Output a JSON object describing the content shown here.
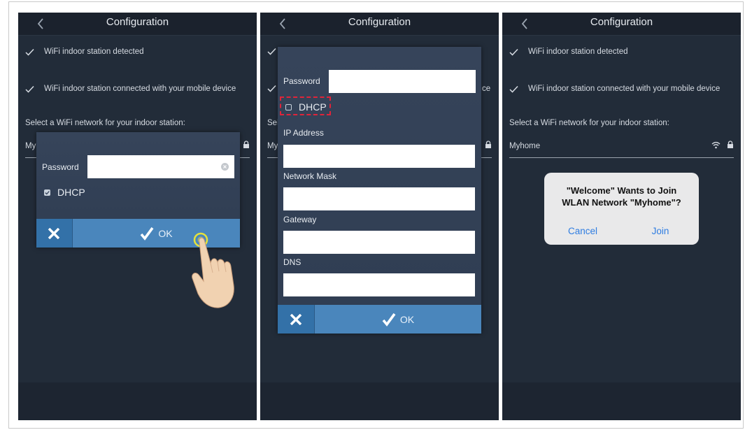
{
  "screens": [
    {
      "nav_title": "Configuration",
      "status_items": [
        "WiFi indoor station detected",
        "WiFi indoor station connected with your mobile device"
      ],
      "select_label": "Select a WiFi network for your indoor station:",
      "network_name": "My",
      "dialog": {
        "password_label": "Password",
        "password_value": "",
        "dhcp_label": "DHCP",
        "dhcp_checked": true,
        "ok_label": "OK"
      }
    },
    {
      "nav_title": "Configuration",
      "status_items": [
        "",
        ""
      ],
      "select_label": "Sel",
      "network_name": "My",
      "partial_text": "ce",
      "dialog": {
        "password_label": "Password",
        "dhcp_label": "DHCP",
        "dhcp_checked": false,
        "ip_label": "IP Address",
        "mask_label": "Network Mask",
        "gateway_label": "Gateway",
        "dns_label": "DNS",
        "ok_label": "OK"
      }
    },
    {
      "nav_title": "Configuration",
      "status_items": [
        "WiFi indoor station detected",
        "WiFi indoor station connected with your mobile device"
      ],
      "select_label": "Select a WiFi network for your indoor station:",
      "network_name": "Myhome",
      "alert": {
        "line1": "\"Welcome\" Wants to Join",
        "line2": "WLAN Network \"Myhome\"?",
        "cancel_label": "Cancel",
        "join_label": "Join"
      }
    }
  ],
  "colors": {
    "screen_bg": "#222c39",
    "navbar_bg": "#1b222d",
    "dialog_bg": "#33415a",
    "ok_button": "#4a86bc",
    "cancel_button": "#3371a8",
    "highlight_dashed": "#e0243a",
    "tap_ring": "#e6e23a",
    "alert_link": "#2f7de1"
  }
}
